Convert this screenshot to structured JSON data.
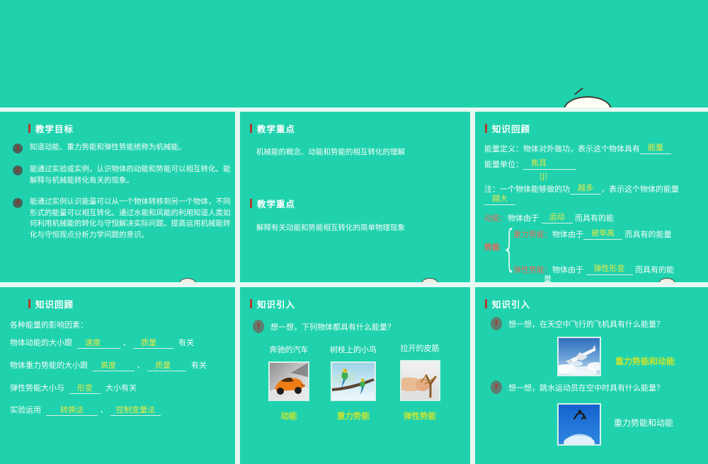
{
  "colors": {
    "slide_bg": "#1fd2ad",
    "gap": "#e7f8f3",
    "title_bar_red": "#b23b32",
    "body_text": "#f6fcfa",
    "answer_yellow": "#e8e748",
    "label_yellow_green": "#c8e431",
    "term_salmon": "#e2685a",
    "bullet_circle": "#47635a",
    "bullet_number_red": "#9c2d24"
  },
  "slides": {
    "objectives": {
      "title": "教学目标",
      "items": [
        {
          "num": "1",
          "text": "知道动能、重力势能和弹性势能统称为机械能。"
        },
        {
          "num": "2",
          "text": "能通过实验或实例，认识物体的动能和势能可以相互转化。能解释与机械能转化有关的现象。"
        },
        {
          "num": "3",
          "text": "能通过实例认识能量可以从一个物体转移到另一个物体，不同形式的能量可以相互转化。通过水能和风能的利用知道人类如何利用机械能的转化与守恒解决实际问题。提高运用机械能转化与守恒观点分析力学问题的意识。"
        }
      ]
    },
    "keypoints": {
      "title1": "教学重点",
      "body1": "机械能的概念、动能和势能的相互转化的理解",
      "title2": "教学重点",
      "body2": "解释有关动能和势能相互转化的简单物理现象"
    },
    "review_energy": {
      "title": "知识回顾",
      "l1_pre": "能量定义：物体对外做功，表示这个物体具有",
      "l1_ans": "能量",
      "l2_pre": "能量单位：",
      "l2_ans": "焦耳",
      "l2_sub": "（J）",
      "l3_pre": "注：一个物体能够做的功",
      "l3_ans": "越多",
      "l3_post": "，表示这个物体的能量",
      "l4_ans": "越大",
      "kinetic_label": "动能：",
      "kinetic_pre": "物体由于",
      "kinetic_ans": "运动",
      "kinetic_post": "而具有的能",
      "potential_label": "势能",
      "gravity_label": "重力势能：",
      "gravity_pre": "物体由于",
      "gravity_ans": "被举高",
      "gravity_post": "而具有的能量",
      "elastic_label": "弹性势能：",
      "elastic_pre": "物体由于",
      "elastic_ans": "弹性形变",
      "elastic_post": "而具有的能",
      "elastic_wrap": "量"
    },
    "review_factors": {
      "title": "知识回顾",
      "intro": "各种能量的影响因素：",
      "kinetic_pre": "物体动能的大小跟",
      "kinetic_a1": "速度",
      "sep": "、",
      "kinetic_a2": "质量",
      "kinetic_post": "有关",
      "gravity_pre": "物体重力势能的大小跟",
      "gravity_a1": "高度",
      "gravity_a2": "质量",
      "gravity_post": "有关",
      "elastic_pre": "弹性势能大小与",
      "elastic_ans": "形变",
      "elastic_post": "大小有关",
      "method_pre": "实验运用",
      "method_a1": "转换法",
      "method_a2": "控制变量法"
    },
    "intro_objects": {
      "title": "知识引入",
      "qmark": "?",
      "question": "想一想，下列物体都具有什么能量？",
      "cards": [
        {
          "caption": "奔驰的汽车",
          "answer": "动能",
          "icon": "car-photo"
        },
        {
          "caption": "树枝上的小鸟",
          "answer": "重力势能",
          "icon": "birds-photo"
        },
        {
          "caption": "拉开的皮筋",
          "answer": "弹性势能",
          "icon": "slingshot-photo"
        }
      ]
    },
    "intro_flight": {
      "title": "知识引入",
      "qmark": "?",
      "q1": "想一想，在天空中飞行的飞机具有什么能量？",
      "a1": "重力势能和动能",
      "plane_icon": "airplane-photo",
      "q2": "想一想，跳水运动员在空中时具有什么能量？",
      "a2": "重力势能和动能",
      "diver_icon": "diver-photo"
    }
  }
}
